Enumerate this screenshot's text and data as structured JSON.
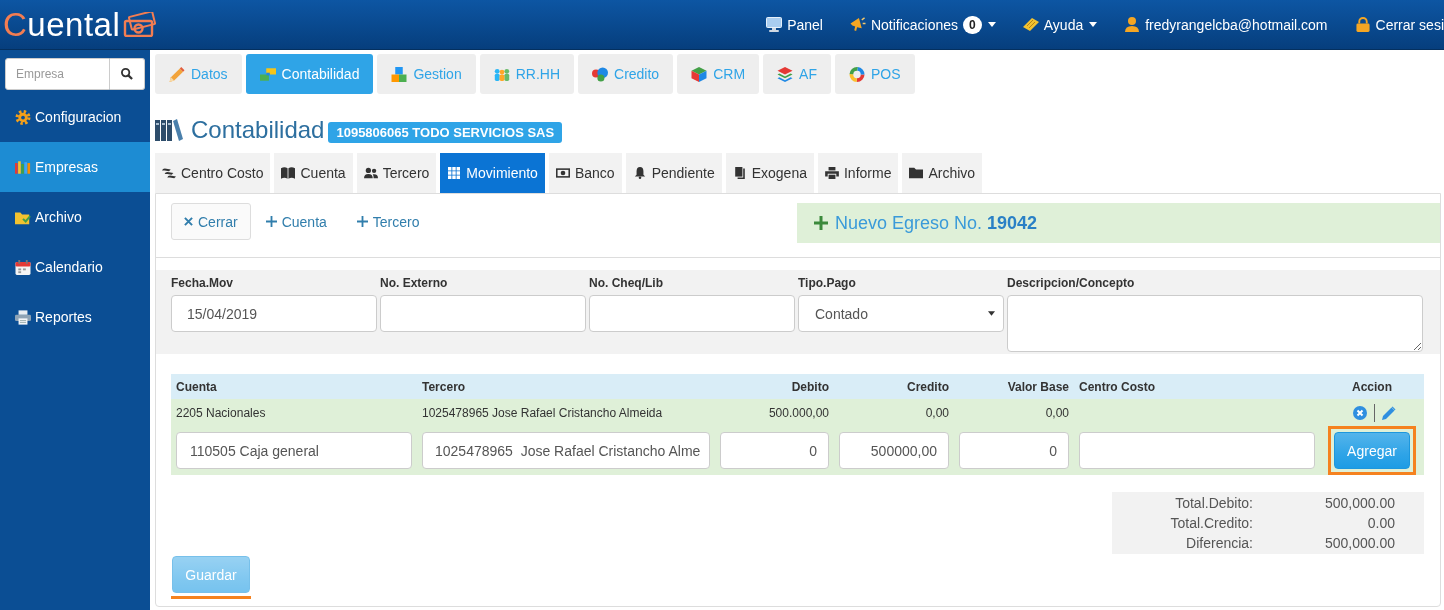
{
  "topbar": {
    "logo": {
      "accent": "C",
      "text": "uental"
    },
    "nav": [
      {
        "kind": "link",
        "label": "Panel"
      },
      {
        "kind": "dropdown",
        "label": "Notificaciones",
        "badge": "0"
      },
      {
        "kind": "dropdown",
        "label": "Ayuda"
      },
      {
        "kind": "link",
        "label": "fredyrangelcba@hotmail.com"
      },
      {
        "kind": "link",
        "label": "Cerrar sesi"
      }
    ]
  },
  "sidebar": {
    "search": {
      "placeholder": "Empresa"
    },
    "items": [
      {
        "label": "Configuracion",
        "selected": false
      },
      {
        "label": "Empresas",
        "selected": true
      },
      {
        "label": "Archivo",
        "selected": false
      },
      {
        "label": "Calendario",
        "selected": false
      },
      {
        "label": "Reportes",
        "selected": false
      }
    ]
  },
  "modules": [
    {
      "label": "Datos",
      "selected": false
    },
    {
      "label": "Contabilidad",
      "selected": true
    },
    {
      "label": "Gestion",
      "selected": false
    },
    {
      "label": "RR.HH",
      "selected": false
    },
    {
      "label": "Credito",
      "selected": false
    },
    {
      "label": "CRM",
      "selected": false
    },
    {
      "label": "AF",
      "selected": false
    },
    {
      "label": "POS",
      "selected": false
    }
  ],
  "page": {
    "title": "Contabilidad",
    "company": "1095806065 TODO SERVICIOS SAS"
  },
  "subtabs": [
    {
      "label": "Centro Costo",
      "selected": false
    },
    {
      "label": "Cuenta",
      "selected": false
    },
    {
      "label": "Tercero",
      "selected": false
    },
    {
      "label": "Movimiento",
      "selected": true
    },
    {
      "label": "Banco",
      "selected": false
    },
    {
      "label": "Pendiente",
      "selected": false
    },
    {
      "label": "Exogena",
      "selected": false
    },
    {
      "label": "Informe",
      "selected": false
    },
    {
      "label": "Archivo",
      "selected": false
    }
  ],
  "toolbar": {
    "close_button": "Cerrar",
    "links": [
      "Cuenta",
      "Tercero"
    ],
    "banner": "Nuevo Egreso No. **19042**"
  },
  "form": {
    "fields": [
      {
        "kind": "input",
        "label": "Fecha.Mov",
        "value": "15/04/2019"
      },
      {
        "kind": "input",
        "label": "No. Externo"
      },
      {
        "kind": "input",
        "label": "No. Cheq/Lib"
      },
      {
        "kind": "select",
        "label": "Tipo.Pago",
        "value": "Contado"
      },
      {
        "kind": "textarea",
        "label": "Descripcion/Concepto"
      }
    ]
  },
  "table": {
    "columns": [
      "Cuenta",
      "Tercero",
      "Debito",
      "Credito",
      "Valor Base",
      "Centro Costo",
      "Accion"
    ],
    "rows": [
      {
        "cuenta": "2205 Nacionales",
        "tercero": "1025478965 Jose Rafael Cristancho Almeida",
        "debito": "500.000,00",
        "credito": "0,00",
        "valor_base": "0,00"
      }
    ]
  },
  "entry": {
    "cuenta": "110505 Caja general",
    "tercero": "1025478965  Jose Rafael Cristancho Alme",
    "debito": "0",
    "credito": "500000,00",
    "valor_base": "0",
    "add_button": {
      "label": "Agregar",
      "highlighted": true
    }
  },
  "totals": [
    {
      "label": "Total.Debito:",
      "value": "500,000.00"
    },
    {
      "label": "Total.Credito:",
      "value": "0.00"
    },
    {
      "label": "Diferencia:",
      "value": "500,000.00"
    }
  ],
  "save_button": {
    "label": "Guardar",
    "disabled": true,
    "underlined": true
  }
}
